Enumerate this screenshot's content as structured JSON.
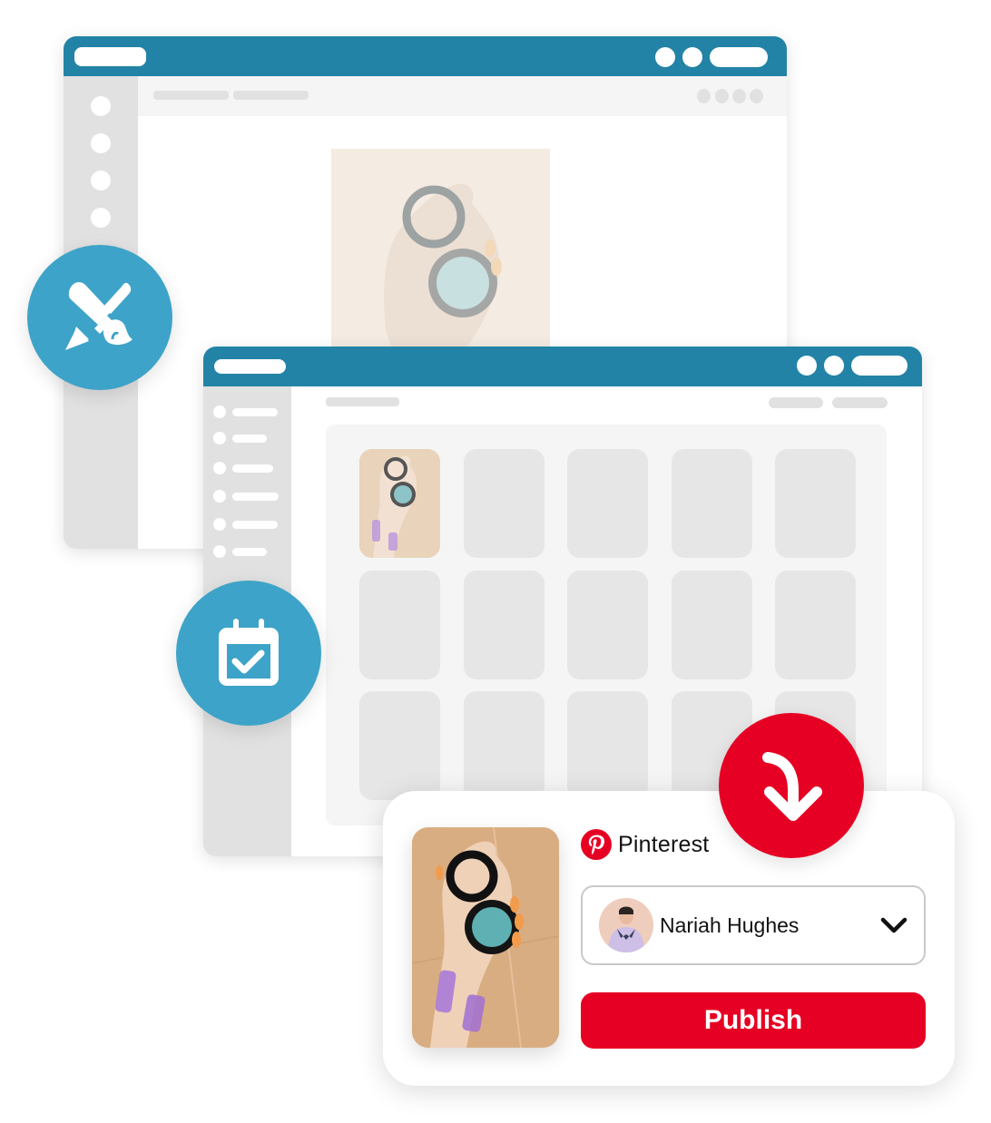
{
  "colors": {
    "titlebar": "#2383a6",
    "feature_bubble": "#3ea3c8",
    "pinterest_red": "#e60023",
    "skeleton": "#e1e1e1",
    "panel": "#f5f5f5"
  },
  "windows": [
    {
      "name": "editor-window",
      "sidebar_icon_count": 4,
      "toolbar_dot_count": 4,
      "hero_image": "compact-mirror-in-hand-photo"
    },
    {
      "name": "scheduler-window",
      "sidebar_item_count": 6,
      "grid": {
        "rows": 3,
        "columns": 5,
        "filled_tiles": 1
      }
    }
  ],
  "feature_icons": [
    {
      "name": "edit",
      "icon": "pencil-brush-icon"
    },
    {
      "name": "schedule",
      "icon": "calendar-check-icon"
    },
    {
      "name": "publish",
      "icon": "curved-arrow-down-icon"
    }
  ],
  "publish_card": {
    "platform": {
      "icon": "pinterest-logo-icon",
      "name": "Pinterest"
    },
    "account": {
      "name": "Nariah Hughes",
      "avatar": "profile-photo"
    },
    "dropdown_icon": "chevron-down-icon",
    "publish_label": "Publish",
    "pin_image": "compact-mirror-in-hand-photo"
  }
}
